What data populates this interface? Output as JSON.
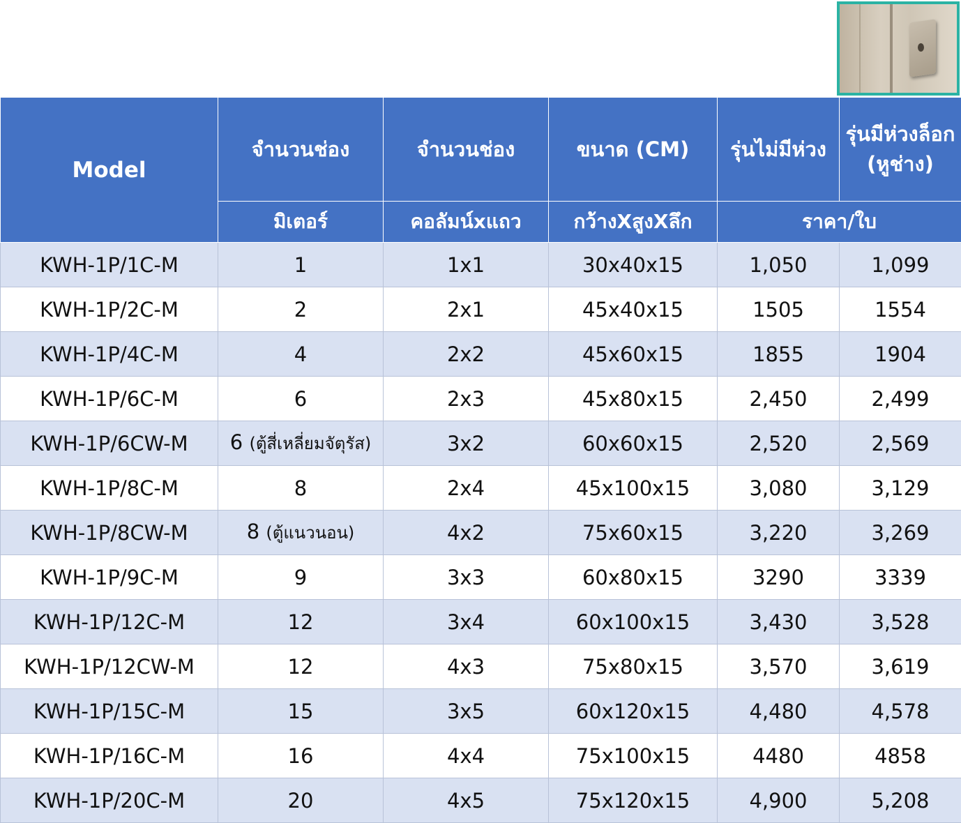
{
  "header": {
    "model": "Model",
    "col2_top": "จำนวนช่อง",
    "col2_bottom": "มิเตอร์",
    "col3_top": "จำนวนช่อง",
    "col3_bottom": "คอลัมน์xแถว",
    "col4_top": "ขนาด (CM)",
    "col4_bottom": "กว้างXสูงXลึก",
    "col5_top": "รุ่นไม่มีห่วง",
    "col6_top_line1": "รุ่นมีห่วงล็อก",
    "col6_top_line2": "(หูช่าง)",
    "price_bottom": "ราคา/ใบ"
  },
  "image": {
    "icon": "cabinet-latch-photo"
  },
  "rows": [
    {
      "model": "KWH-1P/1C-M",
      "meters": "1",
      "note": "",
      "grid": "1x1",
      "size": "30x40x15",
      "price_a": "1,050",
      "price_b": "1,099"
    },
    {
      "model": "KWH-1P/2C-M",
      "meters": "2",
      "note": "",
      "grid": "2x1",
      "size": "45x40x15",
      "price_a": "1505",
      "price_b": "1554"
    },
    {
      "model": "KWH-1P/4C-M",
      "meters": "4",
      "note": "",
      "grid": "2x2",
      "size": "45x60x15",
      "price_a": "1855",
      "price_b": "1904"
    },
    {
      "model": "KWH-1P/6C-M",
      "meters": "6",
      "note": "",
      "grid": "2x3",
      "size": "45x80x15",
      "price_a": "2,450",
      "price_b": "2,499"
    },
    {
      "model": "KWH-1P/6CW-M",
      "meters": "6",
      "note": "(ตู้สี่เหลี่ยมจัตุรัส)",
      "grid": "3x2",
      "size": "60x60x15",
      "price_a": "2,520",
      "price_b": "2,569"
    },
    {
      "model": "KWH-1P/8C-M",
      "meters": "8",
      "note": "",
      "grid": "2x4",
      "size": "45x100x15",
      "price_a": "3,080",
      "price_b": "3,129"
    },
    {
      "model": "KWH-1P/8CW-M",
      "meters": "8",
      "note": "(ตู้แนวนอน)",
      "grid": "4x2",
      "size": "75x60x15",
      "price_a": "3,220",
      "price_b": "3,269"
    },
    {
      "model": "KWH-1P/9C-M",
      "meters": "9",
      "note": "",
      "grid": "3x3",
      "size": "60x80x15",
      "price_a": "3290",
      "price_b": "3339"
    },
    {
      "model": "KWH-1P/12C-M",
      "meters": "12",
      "note": "",
      "grid": "3x4",
      "size": "60x100x15",
      "price_a": "3,430",
      "price_b": "3,528"
    },
    {
      "model": "KWH-1P/12CW-M",
      "meters": "12",
      "note": "",
      "grid": "4x3",
      "size": "75x80x15",
      "price_a": "3,570",
      "price_b": "3,619"
    },
    {
      "model": "KWH-1P/15C-M",
      "meters": "15",
      "note": "",
      "grid": "3x5",
      "size": "60x120x15",
      "price_a": "4,480",
      "price_b": "4,578"
    },
    {
      "model": "KWH-1P/16C-M",
      "meters": "16",
      "note": "",
      "grid": "4x4",
      "size": "75x100x15",
      "price_a": "4480",
      "price_b": "4858"
    },
    {
      "model": "KWH-1P/20C-M",
      "meters": "20",
      "note": "",
      "grid": "4x5",
      "size": "75x120x15",
      "price_a": "4,900",
      "price_b": "5,208"
    }
  ]
}
